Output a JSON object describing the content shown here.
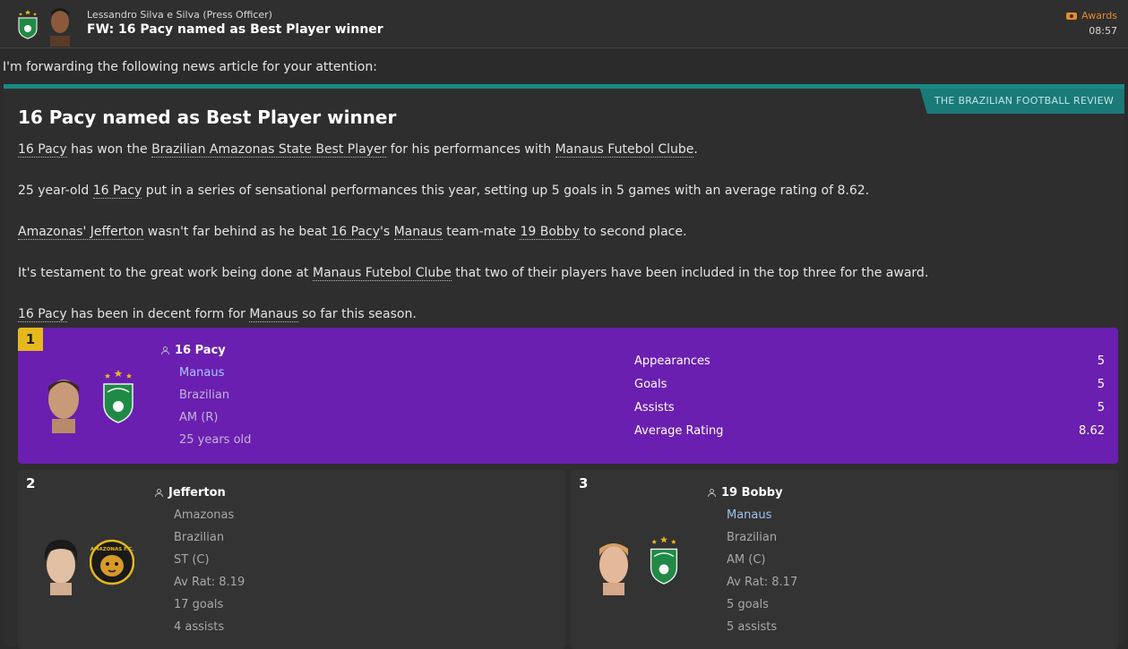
{
  "header": {
    "sender": "Lessandro Silva e Silva  (Press Officer)",
    "subject": "FW: 16 Pacy named as Best Player winner",
    "tag": "Awards",
    "time": "08:57",
    "tag_color": "#e88a2e"
  },
  "intro": "I'm forwarding the following news article for your attention:",
  "article": {
    "source": "THE BRAZILIAN FOOTBALL REVIEW",
    "headline": "16 Pacy named as Best Player winner",
    "p1": {
      "a": "16 Pacy",
      "b": " has won the ",
      "c": "Brazilian Amazonas State Best Player",
      "d": " for his performances with ",
      "e": "Manaus Futebol Clube",
      "f": "."
    },
    "p2": {
      "a": "25 year-old ",
      "b": "16 Pacy",
      "c": " put in a series of sensational performances this year, setting up 5 goals in 5 games with an average rating of 8.62."
    },
    "p3": {
      "a": "Amazonas' Jefferton",
      "b": " wasn't far behind as he beat ",
      "c": "16 Pacy",
      "d": "'s ",
      "e": "Manaus",
      "f": " team-mate ",
      "g": "19 Bobby",
      "h": " to second place."
    },
    "p4": {
      "a": "It's testament to the great work being done at ",
      "b": "Manaus Futebol Clube",
      "c": " that two of their players have been included in the top three for the award."
    },
    "p5": {
      "a": "16 Pacy",
      "b": " has been in decent form for ",
      "c": "Manaus",
      "d": " so far this season."
    },
    "accent_color": "#1a8a86"
  },
  "winner": {
    "rank": "1",
    "name": "16 Pacy",
    "club": "Manaus",
    "nationality": "Brazilian",
    "position": "AM (R)",
    "age": "25 years old",
    "stats": [
      {
        "label": "Appearances",
        "value": "5"
      },
      {
        "label": "Goals",
        "value": "5"
      },
      {
        "label": "Assists",
        "value": "5"
      },
      {
        "label": "Average Rating",
        "value": "8.62"
      }
    ],
    "card_color": "#6a1fb0"
  },
  "second": {
    "rank": "2",
    "name": "Jefferton",
    "club": "Amazonas",
    "nationality": "Brazilian",
    "position": "ST (C)",
    "rating": "Av Rat: 8.19",
    "goals": "17 goals",
    "assists": "4 assists"
  },
  "third": {
    "rank": "3",
    "name": "19 Bobby",
    "club": "Manaus",
    "nationality": "Brazilian",
    "position": "AM (C)",
    "rating": "Av Rat: 8.17",
    "goals": "5 goals",
    "assists": "5 assists"
  },
  "badges": {
    "amazonas_text": "AMAZONAS F.C."
  }
}
